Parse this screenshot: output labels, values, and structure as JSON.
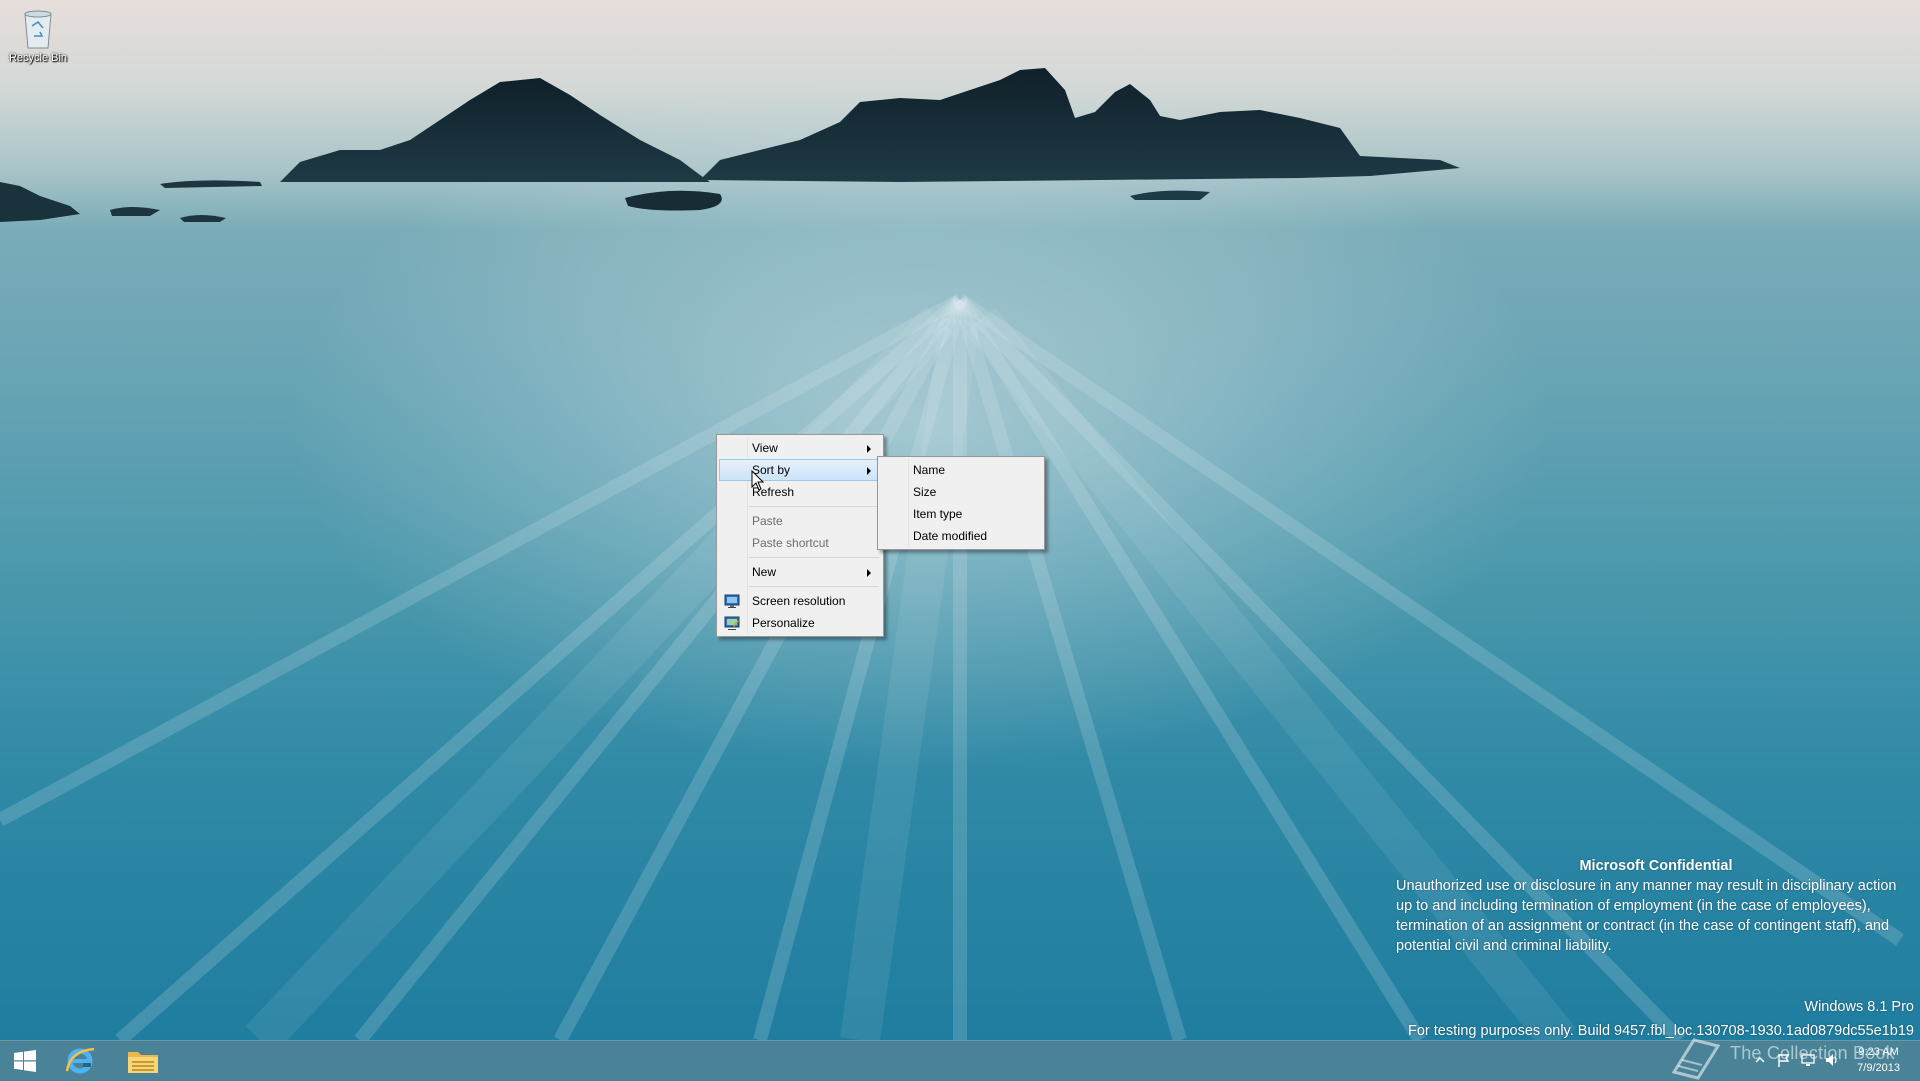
{
  "desktop": {
    "recycle_bin_label": "Recycle Bin"
  },
  "context_menu": {
    "items": [
      {
        "label": "View",
        "has_submenu": true,
        "state": "normal"
      },
      {
        "label": "Sort by",
        "has_submenu": true,
        "state": "highlighted"
      },
      {
        "label": "Refresh",
        "has_submenu": false,
        "state": "normal"
      },
      {
        "label": "Paste",
        "has_submenu": false,
        "state": "disabled"
      },
      {
        "label": "Paste shortcut",
        "has_submenu": false,
        "state": "disabled"
      },
      {
        "label": "New",
        "has_submenu": true,
        "state": "normal"
      },
      {
        "label": "Screen resolution",
        "has_submenu": false,
        "state": "normal",
        "icon": "display-icon"
      },
      {
        "label": "Personalize",
        "has_submenu": false,
        "state": "normal",
        "icon": "personalize-icon"
      }
    ]
  },
  "sort_submenu": {
    "items": [
      {
        "label": "Name"
      },
      {
        "label": "Size"
      },
      {
        "label": "Item type"
      },
      {
        "label": "Date modified"
      }
    ]
  },
  "watermark": {
    "title": "Microsoft Confidential",
    "body": "Unauthorized use or disclosure in any manner may result in disciplinary action up to and including termination of employment (in the case of employees), termination of an assignment or contract (in the case of contingent staff), and potential civil and criminal liability.",
    "edition": "Windows 8.1 Pro",
    "build": "For testing purposes only. Build 9457.fbl_loc.130708-1930.1ad0879dc55e1b19"
  },
  "taskbar": {
    "pinned": [
      "start-button",
      "internet-explorer",
      "file-explorer"
    ],
    "overlay_text": "The Collection Book",
    "clock_time": "9:23 AM",
    "clock_date": "7/9/2013"
  },
  "colors": {
    "accent_highlight": "#cbe2f9",
    "taskbar": "#226880",
    "menu_background": "#f0f0f0"
  }
}
